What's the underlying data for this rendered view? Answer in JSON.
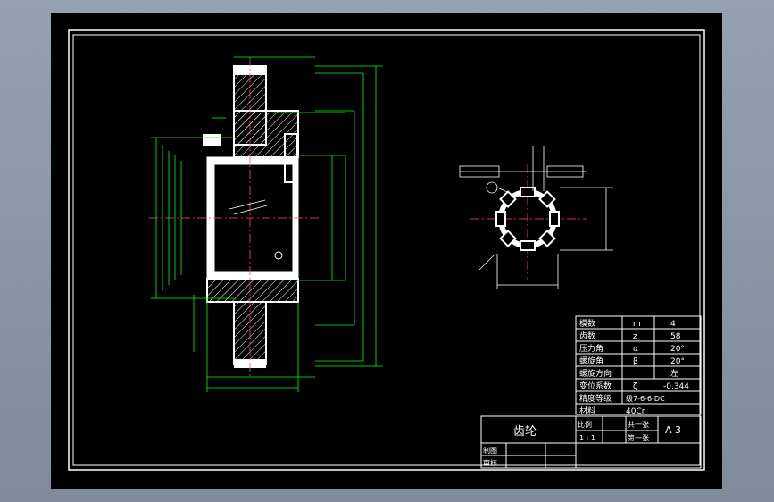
{
  "title_block": {
    "part_name": "齿轮",
    "scale_label": "比例",
    "scale_value": "1 : 1",
    "sheet_total": "共一张",
    "sheet_no": "第一张",
    "paper_size": "A 3",
    "drawn_by": "制图",
    "checked_by": "审核"
  },
  "param_table": {
    "rows": [
      {
        "name": "模数",
        "symbol": "m",
        "value": "4"
      },
      {
        "name": "齿数",
        "symbol": "z",
        "value": "58"
      },
      {
        "name": "压力角",
        "symbol": "α",
        "value": "20°"
      },
      {
        "name": "螺旋角",
        "symbol": "β",
        "value": "20°"
      },
      {
        "name": "螺旋方向",
        "symbol": "",
        "value": "左"
      },
      {
        "name": "变位系数",
        "symbol": "ζ",
        "value": "-0.344"
      },
      {
        "name": "精度等级",
        "symbol": "",
        "value": "级7-6-6-DC"
      }
    ],
    "material_label": "材料",
    "material_value": "40Cr"
  },
  "colors": {
    "sheet": "#000000",
    "outline": "#ffffff",
    "dimension": "#00ff00",
    "hatch": "#ffffff"
  }
}
